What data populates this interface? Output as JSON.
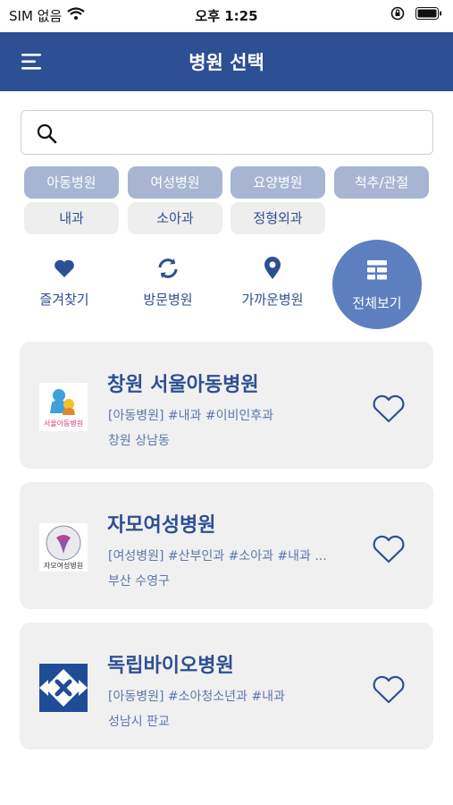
{
  "status_bar": {
    "carrier": "SIM 없음",
    "time": "오후 1:25"
  },
  "header": {
    "title": "병원 선택"
  },
  "search": {
    "placeholder": "",
    "value": ""
  },
  "categories": {
    "row1": [
      "아동병원",
      "여성병원",
      "요양병원",
      "척추/관절"
    ],
    "row2": [
      "내과",
      "소아과",
      "정형외과"
    ]
  },
  "quick_menu": {
    "favorites": "즐겨찾기",
    "visited": "방문병원",
    "nearby": "가까운병원",
    "all": "전체보기"
  },
  "hospitals": [
    {
      "name": "창원 서울아동병원",
      "tags": "[아동병원] #내과 #이비인후과",
      "location": "창원 상남동",
      "logo_text": "서울아동병원"
    },
    {
      "name": "자모여성병원",
      "tags": "[여성병원] #산부인과 #소아과 #내과 ...",
      "location": "부산 수영구",
      "logo_text": "자모여성병원"
    },
    {
      "name": "독립바이오병원",
      "tags": "[아동병원] #소아청소년과 #내과",
      "location": "성남시 판교",
      "logo_text": ""
    }
  ],
  "colors": {
    "header": "#2d4f93",
    "chip_primary": "#a7b5d2",
    "chip_secondary": "#eeeeee",
    "card_bg": "#f0f0f0",
    "accent": "#5d7fbf"
  }
}
